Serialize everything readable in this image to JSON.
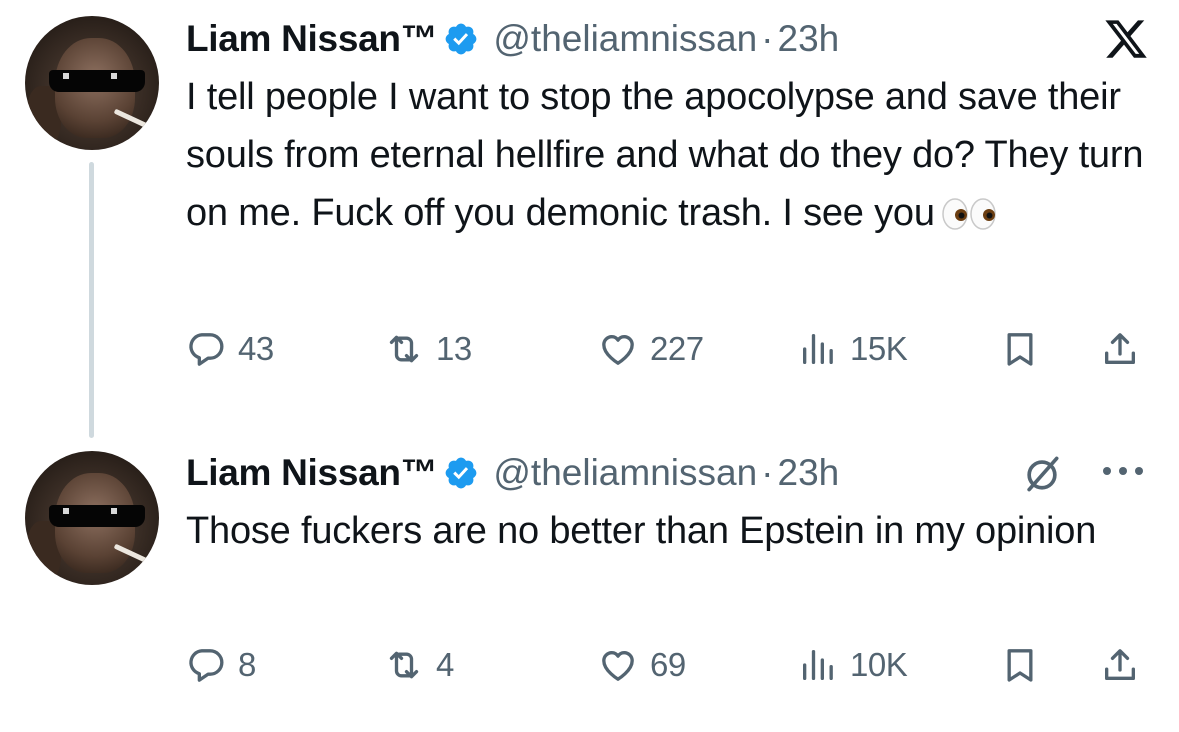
{
  "colors": {
    "text": "#0f1419",
    "secondary": "#536471",
    "verified": "#1d9bf0",
    "thread_line": "#cfd9de"
  },
  "tweets": [
    {
      "author_name": "Liam Nissan™",
      "handle": "@theliamnissan",
      "separator": "·",
      "time": "23h",
      "text": "I tell people I want to stop the apocolypse and save their souls from eternal hellfire and what do they do? They turn on me. Fuck off you demonic trash. I see you",
      "emoji": "eyes-emoji",
      "replies": "43",
      "retweets": "13",
      "likes": "227",
      "views": "15K",
      "corner_icon": "x-logo-icon"
    },
    {
      "author_name": "Liam Nissan™",
      "handle": "@theliamnissan",
      "separator": "·",
      "time": "23h",
      "text": "Those fuckers are no better than Epstein in my opinion",
      "replies": "8",
      "retweets": "4",
      "likes": "69",
      "views": "10K",
      "corner_icons": [
        "grok-icon",
        "more-icon"
      ]
    }
  ]
}
